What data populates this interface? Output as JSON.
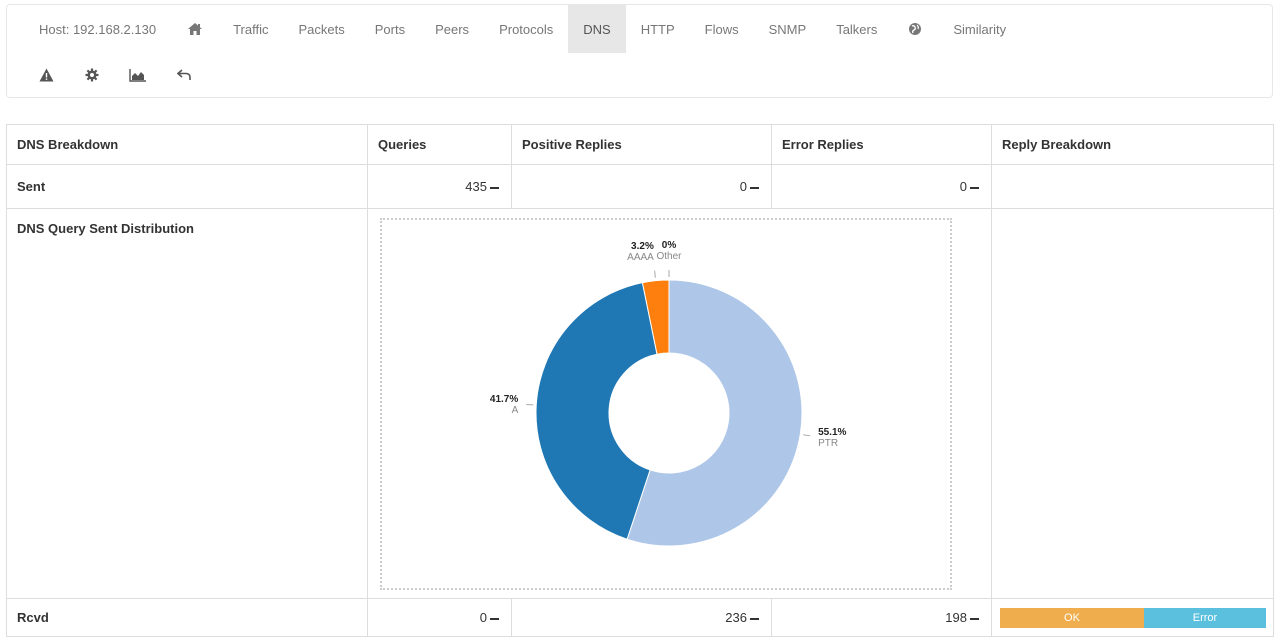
{
  "nav": {
    "host": "Host: 192.168.2.130",
    "items": [
      "Traffic",
      "Packets",
      "Ports",
      "Peers",
      "Protocols",
      "DNS",
      "HTTP",
      "Flows",
      "SNMP",
      "Talkers"
    ],
    "active": "DNS",
    "similarity": "Similarity"
  },
  "table": {
    "headers": [
      "DNS Breakdown",
      "Queries",
      "Positive Replies",
      "Error Replies",
      "Reply Breakdown"
    ],
    "sent": {
      "label": "Sent",
      "queries": "435",
      "positive": "0",
      "error": "0"
    },
    "distribution_label": "DNS Query Sent Distribution",
    "rcvd": {
      "label": "Rcvd",
      "queries": "0",
      "positive": "236",
      "error": "198"
    },
    "reply_breakdown": {
      "ok": "OK",
      "error": "Error",
      "ok_color": "#f0ad4e",
      "error_color": "#5bc0de"
    }
  },
  "chart_data": {
    "type": "pie",
    "donut": true,
    "slices": [
      {
        "label": "PTR",
        "value": 55.1,
        "display": "55.1%",
        "color": "#aec7e8"
      },
      {
        "label": "A",
        "value": 41.7,
        "display": "41.7%",
        "color": "#1f77b4"
      },
      {
        "label": "AAAA",
        "value": 3.2,
        "display": "3.2%",
        "color": "#ff7f0e"
      },
      {
        "label": "Other",
        "value": 0.0,
        "display": "0%",
        "color": "#ffbb78"
      }
    ]
  }
}
